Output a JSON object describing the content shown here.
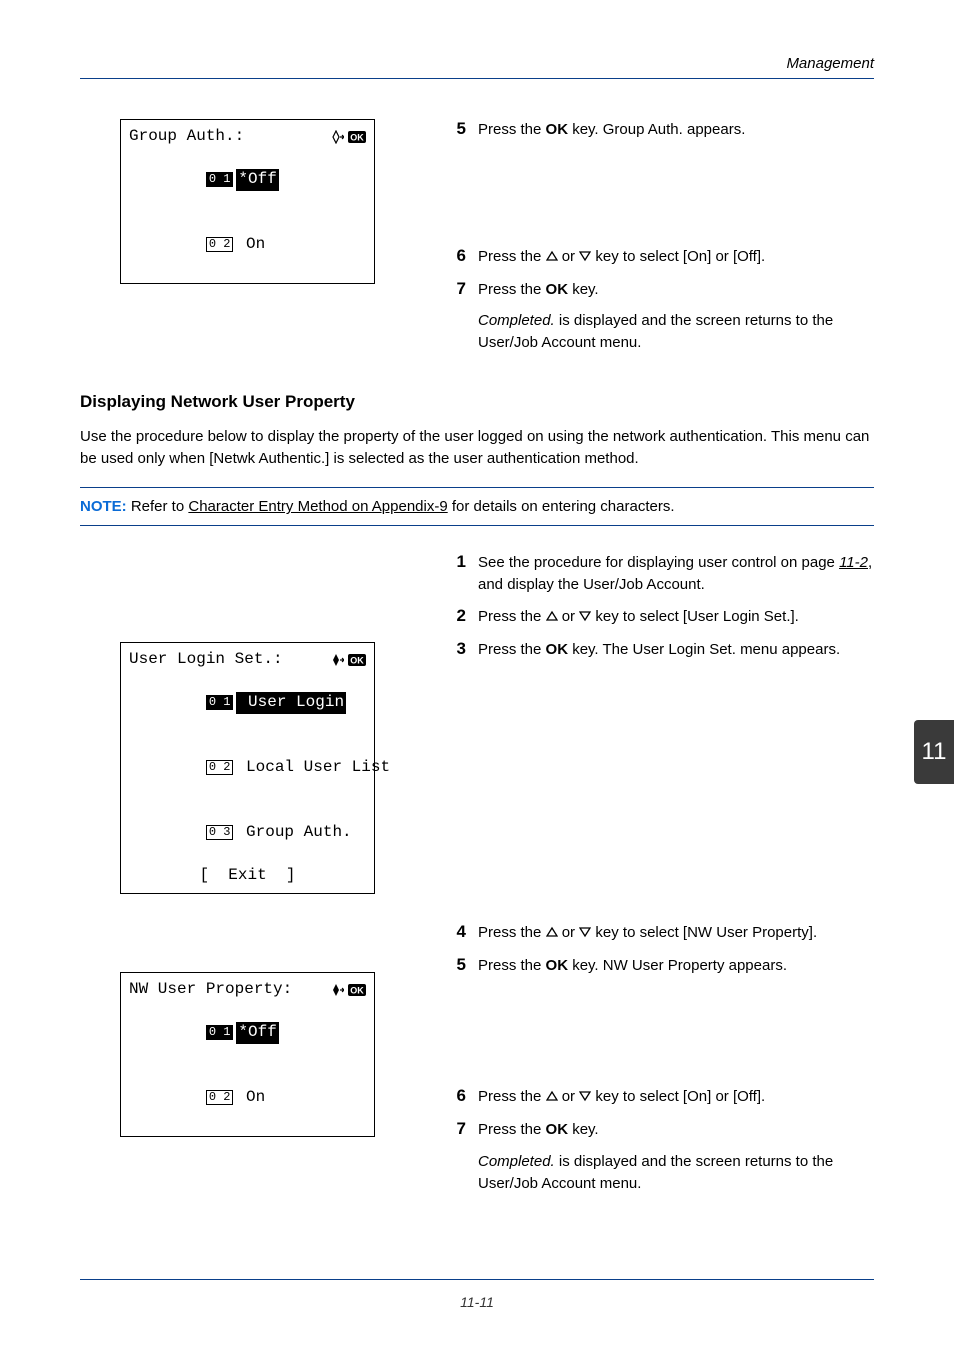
{
  "header": "Management",
  "lcd1": {
    "title": "Group Auth.:",
    "sel_num": "0 1",
    "sel_text": "*Off",
    "line2_num": "0 2",
    "line2_text": " On"
  },
  "steps1": {
    "s5n": "5",
    "s5a": "Press the ",
    "s5b": "OK",
    "s5c": " key. Group Auth. appears.",
    "s6n": "6",
    "s6a": "Press the ",
    "s6b": " or ",
    "s6c": " key to select [On] or [Off].",
    "s7n": "7",
    "s7a": "Press the ",
    "s7b": "OK",
    "s7c": " key.",
    "s7d": "Completed.",
    "s7e": " is displayed and the screen returns to the User/Job Account menu."
  },
  "section_heading": "Displaying Network User Property",
  "para": "Use the procedure below to display the property of the user logged on using the network authentication. This menu can be used only when [Netwk Authentic.] is selected as the user authentication method.",
  "note": {
    "label": "NOTE:",
    "a": " Refer to ",
    "link": "Character Entry Method on Appendix-9",
    "b": " for details on entering characters."
  },
  "steps2": {
    "s1n": "1",
    "s1a": "See the procedure for displaying user control on page ",
    "s1b": "11-2",
    "s1c": ", and display the User/Job Account.",
    "s2n": "2",
    "s2a": "Press the ",
    "s2b": " or ",
    "s2c": " key to select [User Login Set.].",
    "s3n": "3",
    "s3a": "Press the ",
    "s3b": "OK",
    "s3c": " key. The User Login Set. menu appears.",
    "s4n": "4",
    "s4a": "Press the ",
    "s4b": " or ",
    "s4c": " key to select [NW User Property].",
    "s5n": "5",
    "s5a": "Press the ",
    "s5b": "OK",
    "s5c": " key. NW User Property appears.",
    "s6n": "6",
    "s6a": "Press the ",
    "s6b": " or ",
    "s6c": " key to select [On] or [Off].",
    "s7n": "7",
    "s7a": "Press the ",
    "s7b": "OK",
    "s7c": " key.",
    "s7d": "Completed.",
    "s7e": " is displayed and the screen returns to the User/Job Account menu."
  },
  "lcd2": {
    "title": "User Login Set.:",
    "l1_num": "0 1",
    "l1_text": " User Login",
    "l2_num": "0 2",
    "l2_text": " Local User List",
    "l3_num": "0 3",
    "l3_text": " Group Auth.",
    "exit": "[  Exit  ]"
  },
  "lcd3": {
    "title": "NW User Property",
    "colon": ":",
    "sel_num": "0 1",
    "sel_text": "*Off",
    "line2_num": "0 2",
    "line2_text": " On"
  },
  "sidetab": "11",
  "footer": "11-11"
}
